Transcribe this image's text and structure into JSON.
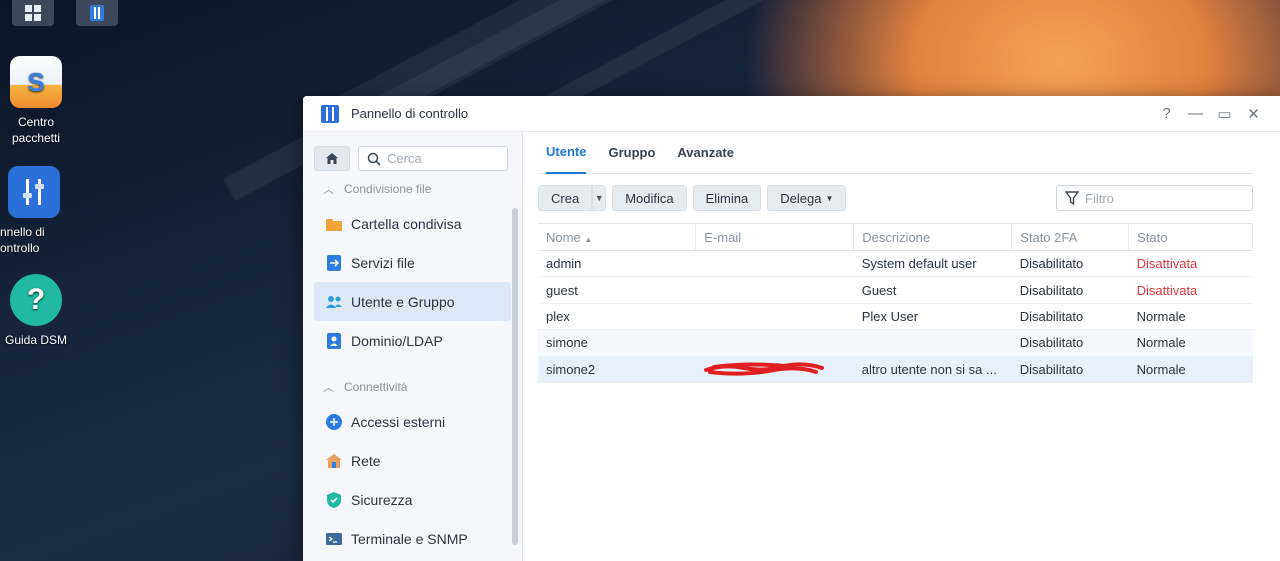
{
  "desktop": {
    "icons": [
      {
        "label": "Centro pacchetti"
      },
      {
        "label": "nnello di controllo"
      },
      {
        "label": "Guida DSM"
      }
    ]
  },
  "window": {
    "title": "Pannello di controllo",
    "controls": {
      "help": "?",
      "minimize": "—",
      "maximize": "▭",
      "close": "✕"
    }
  },
  "sidebar": {
    "search_placeholder": "Cerca",
    "sections": [
      {
        "label": "Condivisione file"
      },
      {
        "label": "Connettività"
      }
    ],
    "items": [
      {
        "label": "Cartella condivisa"
      },
      {
        "label": "Servizi file"
      },
      {
        "label": "Utente e Gruppo"
      },
      {
        "label": "Dominio/LDAP"
      },
      {
        "label": "Accessi esterni"
      },
      {
        "label": "Rete"
      },
      {
        "label": "Sicurezza"
      },
      {
        "label": "Terminale e SNMP"
      }
    ]
  },
  "main": {
    "tabs": [
      {
        "label": "Utente"
      },
      {
        "label": "Gruppo"
      },
      {
        "label": "Avanzate"
      }
    ],
    "toolbar": {
      "create": "Crea",
      "edit": "Modifica",
      "delete": "Elimina",
      "delegate": "Delega",
      "filter_placeholder": "Filtro"
    },
    "columns": [
      "Nome",
      "E-mail",
      "Descrizione",
      "Stato 2FA",
      "Stato"
    ],
    "rows": [
      {
        "name": "admin",
        "email": "",
        "description": "System default user",
        "twofa": "Disabilitato",
        "status": "Disattivata"
      },
      {
        "name": "guest",
        "email": "",
        "description": "Guest",
        "twofa": "Disabilitato",
        "status": "Disattivata"
      },
      {
        "name": "plex",
        "email": "",
        "description": "Plex User",
        "twofa": "Disabilitato",
        "status": "Normale"
      },
      {
        "name": "simone",
        "email": "",
        "description": "",
        "twofa": "Disabilitato",
        "status": "Normale"
      },
      {
        "name": "simone2",
        "email": "",
        "description": "altro utente non si sa ...",
        "twofa": "Disabilitato",
        "status": "Normale"
      }
    ]
  },
  "colors": {
    "accent": "#1a7ad4",
    "danger": "#e0363c"
  }
}
